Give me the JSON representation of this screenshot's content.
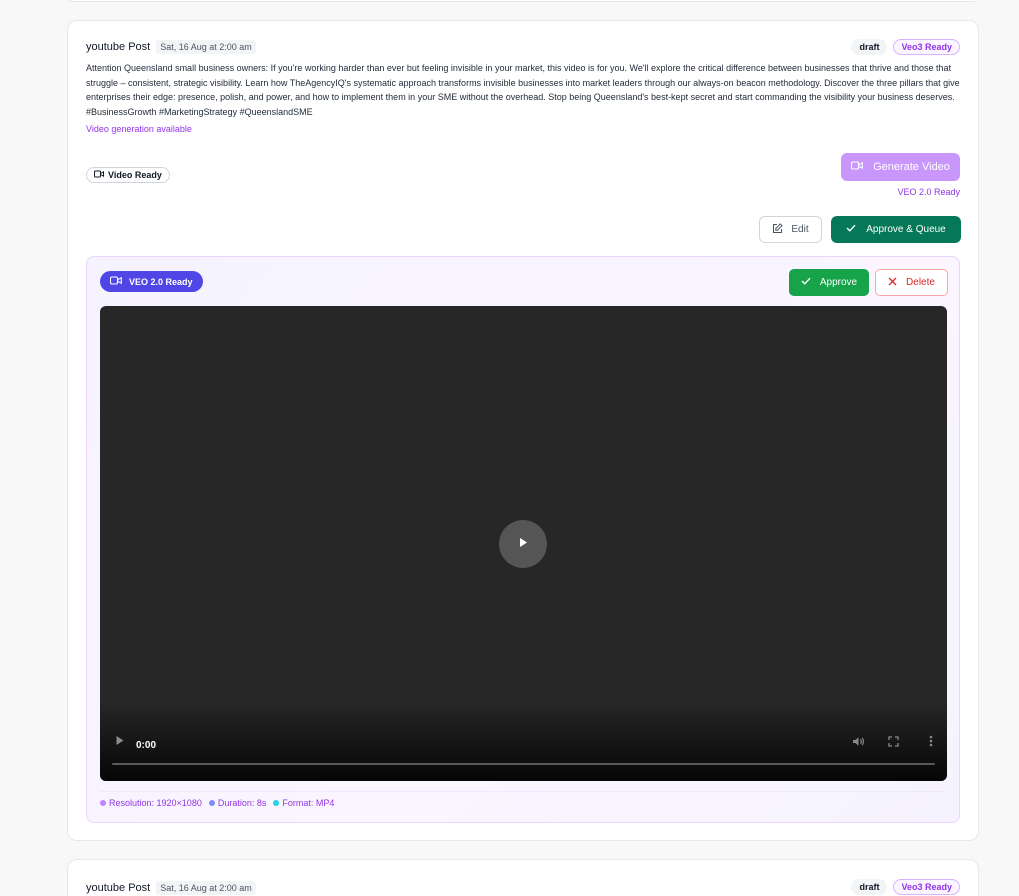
{
  "post": {
    "platform": "youtube Post",
    "date": "Sat, 16 Aug at 2:00 am",
    "status_badge": "draft",
    "ready_badge": "Veo3 Ready",
    "body": "Attention Queensland small business owners: If you're working harder than ever but feeling invisible in your market, this video is for you. We'll explore the critical difference between businesses that thrive and those that struggle – consistent, strategic visibility. Learn how TheAgencyIQ's systematic approach transforms invisible businesses into market leaders through our always-on beacon methodology. Discover the three pillars that give enterprises their edge: presence, polish, and power, and how to implement them in your SME without the overhead. Stop being Queensland's best-kept secret and start commanding the visibility your business deserves. #BusinessGrowth #MarketingStrategy #QueenslandSME",
    "video_generation_note": "Video generation available",
    "video_ready_chip": "Video Ready",
    "generate_button": "Generate Video",
    "veo_ready_text": "VEO 2.0 Ready",
    "edit_button": "Edit",
    "approve_queue_button": "Approve & Queue"
  },
  "video_panel": {
    "badge": "VEO 2.0 Ready",
    "approve_button": "Approve",
    "delete_button": "Delete",
    "player": {
      "current_time": "0:00",
      "progress": 0
    },
    "meta": [
      {
        "label": "Resolution: 1920×1080",
        "color": "#c084fc"
      },
      {
        "label": "Duration: 8s",
        "color": "#818cf8"
      },
      {
        "label": "Format: MP4",
        "color": "#22d3ee"
      }
    ]
  },
  "next_post": {
    "platform": "youtube Post",
    "date": "Sat, 16 Aug at 2:00 am",
    "status_badge": "draft",
    "ready_badge": "Veo3 Ready"
  },
  "colors": {
    "accent_purple": "#9333ea",
    "approve_green": "#16a34a",
    "approve_queue_green": "#047857",
    "veo_badge_indigo": "#4f46e5",
    "delete_red": "#dc2626"
  }
}
